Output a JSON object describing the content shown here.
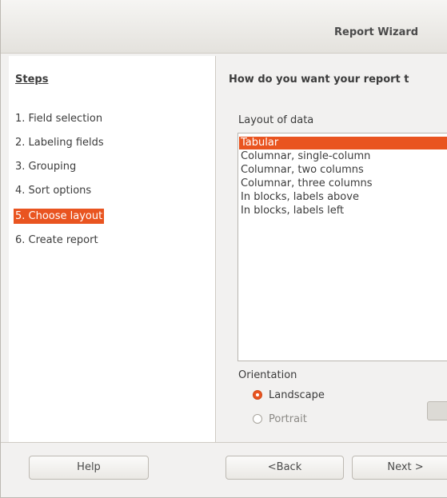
{
  "window": {
    "title": "Report Wizard"
  },
  "steps": {
    "heading": "Steps",
    "items": [
      {
        "label": "1. Field selection",
        "active": false
      },
      {
        "label": "2. Labeling fields",
        "active": false
      },
      {
        "label": "3. Grouping",
        "active": false
      },
      {
        "label": "4. Sort options",
        "active": false
      },
      {
        "label": "5. Choose layout",
        "active": true
      },
      {
        "label": "6. Create report",
        "active": false
      }
    ]
  },
  "content": {
    "question": "How do you want your report t",
    "layout_label": "Layout of data",
    "layout_options": [
      {
        "label": "Tabular",
        "selected": true
      },
      {
        "label": "Columnar, single-column",
        "selected": false
      },
      {
        "label": "Columnar, two columns",
        "selected": false
      },
      {
        "label": "Columnar, three columns",
        "selected": false
      },
      {
        "label": "In blocks, labels above",
        "selected": false
      },
      {
        "label": "In blocks, labels left",
        "selected": false
      }
    ],
    "orientation_label": "Orientation",
    "orientation_options": [
      {
        "label": "Landscape",
        "checked": true
      },
      {
        "label": "Portrait",
        "checked": false
      }
    ]
  },
  "buttons": {
    "help": "Help",
    "back": "<Back",
    "next": "Next >"
  },
  "colors": {
    "accent": "#e95420"
  }
}
